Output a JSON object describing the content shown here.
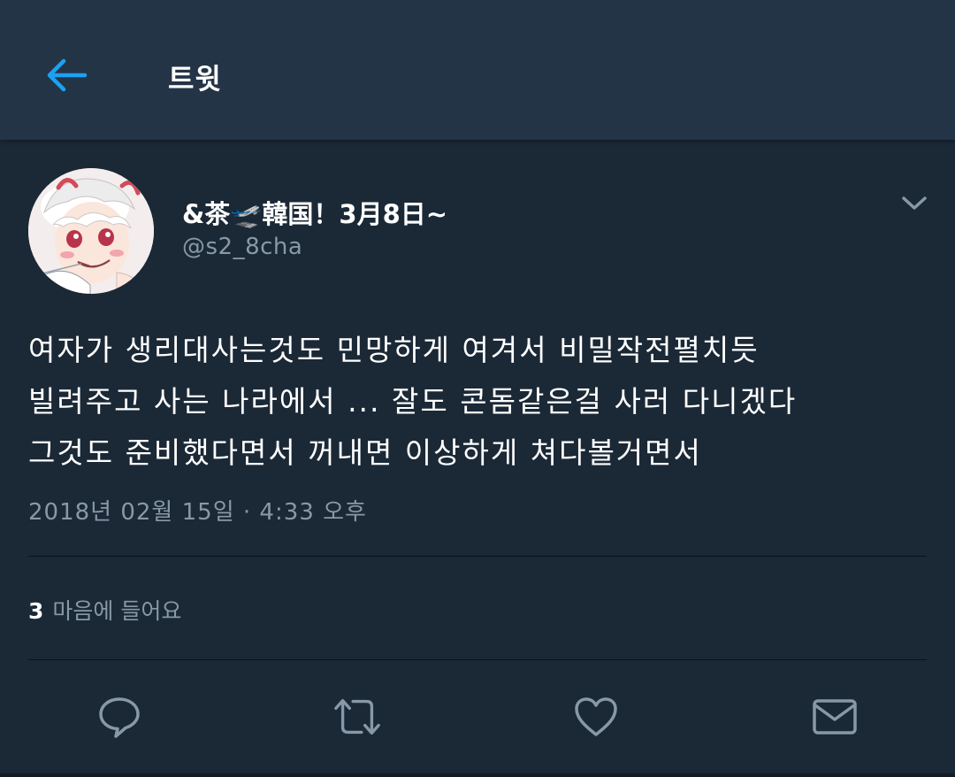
{
  "header": {
    "back_icon": "arrow-left-icon",
    "title": "트윗"
  },
  "tweet": {
    "display_name": "&茶🛫韓国！3月8日~",
    "handle": "@s2_8cha",
    "text": "여자가 생리대사는것도 민망하게 여겨서 비밀작전펼치듯\n빌려주고 사는 나라에서 ... 잘도 콘돔같은걸 사러 다니겠다\n그것도 준비했다면서 꺼내면 이상하게 쳐다볼거면서",
    "timestamp": "2018년 02월 15일 · 4:33 오후",
    "likes_count": "3",
    "likes_label": "마음에 들어요"
  },
  "actions": {
    "reply_icon": "reply-icon",
    "retweet_icon": "retweet-icon",
    "like_icon": "heart-icon",
    "dm_icon": "envelope-icon"
  },
  "colors": {
    "background": "#1b2836",
    "header": "#243447",
    "accent": "#1da1f2",
    "secondary_text": "#8899a6"
  }
}
